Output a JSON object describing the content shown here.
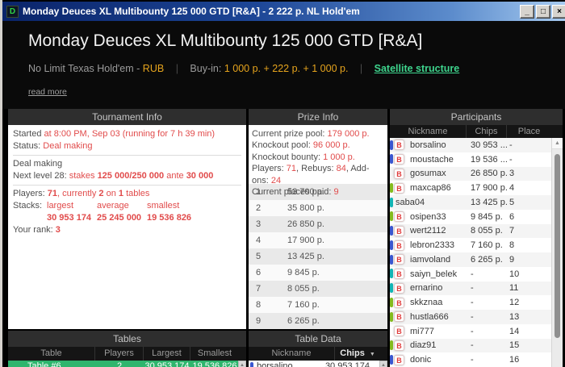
{
  "titlebar": {
    "title": "Monday Deuces XL Multibounty 125 000 GTD [R&A] - 2 222 р. NL Hold'em",
    "icon_letter": "D",
    "minimize_glyph": "_",
    "maximize_glyph": "□",
    "close_glyph": "×"
  },
  "header": {
    "title": "Monday Deuces XL Multibounty 125 000 GTD [R&A]",
    "game_type": "No Limit Texas Hold'em - ",
    "currency": "RUB",
    "pipe": "|",
    "buyin_label": "Buy-in: ",
    "buyin_value": "1 000 р. + 222 р. + 1 000 р.",
    "satellite_link": "Satellite structure",
    "read_more": "read more"
  },
  "tournament_info": {
    "title": "Tournament Info",
    "started_label": "Started",
    "started_value": " at 8:00 PM, Sep 03 (running for 7 h 39 min)",
    "status_label": "Status: ",
    "status_value": "Deal making",
    "deal_making": "Deal making",
    "next_level_label": "Next level 28: ",
    "stakes_word": "stakes ",
    "stakes_value": "125 000/250 000",
    "ante_word": " ante ",
    "ante_value": "30 000",
    "players_label": "Players: ",
    "players_count": "71",
    "players_seg1": ", currently ",
    "players_current": "2",
    "players_seg2": " on ",
    "players_tables": "1",
    "players_seg3": " tables",
    "stacks_label": "Stacks:",
    "stacks_headers": [
      "largest",
      "average",
      "smallest"
    ],
    "stacks_values": [
      "30 953 174",
      "25 245 000",
      "19 536 826"
    ],
    "rank_label": "Your rank: ",
    "rank_value": "3"
  },
  "prize_info": {
    "title": "Prize Info",
    "prize_pool_label": "Current prize pool: ",
    "prize_pool_value": "179 000 р.",
    "knockout_pool_label": "Knockout pool: ",
    "knockout_pool_value": "96 000 р.",
    "knockout_bounty_label": "Knockout bounty: ",
    "knockout_bounty_value": "1 000 р.",
    "players_label": "Players: ",
    "players_value": "71",
    "rebuys_label": ", Rebuys: ",
    "rebuys_value": "84",
    "addons_label": ", Add-ons: ",
    "addons_value": "24",
    "places_paid_label": "Current places paid: ",
    "places_paid_value": "9",
    "places": [
      {
        "place": "1",
        "amount": "53 700 р."
      },
      {
        "place": "2",
        "amount": "35 800 р."
      },
      {
        "place": "3",
        "amount": "26 850 р."
      },
      {
        "place": "4",
        "amount": "17 900 р."
      },
      {
        "place": "5",
        "amount": "13 425 р."
      },
      {
        "place": "6",
        "amount": "9 845 р."
      },
      {
        "place": "7",
        "amount": "8 055 р."
      },
      {
        "place": "8",
        "amount": "7 160 р."
      },
      {
        "place": "9",
        "amount": "6 265 р."
      }
    ]
  },
  "participants": {
    "title": "Participants",
    "columns": [
      "Nickname",
      "Chips",
      "Place"
    ],
    "rows": [
      {
        "flag": "blue",
        "bounty": true,
        "nick": "borsalino",
        "chips": "30 953 ...",
        "place": "-"
      },
      {
        "flag": "blue",
        "bounty": true,
        "nick": "moustache",
        "chips": "19 536 ...",
        "place": "-"
      },
      {
        "flag": "",
        "bounty": true,
        "nick": "gosumax",
        "chips": "26 850 р.",
        "place": "3"
      },
      {
        "flag": "green",
        "bounty": true,
        "nick": "maxcap86",
        "chips": "17 900 р.",
        "place": "4"
      },
      {
        "flag": "teal",
        "bounty": false,
        "nick": "saba04",
        "chips": "13 425 р.",
        "place": "5"
      },
      {
        "flag": "green",
        "bounty": true,
        "nick": "osipen33",
        "chips": "9 845 р.",
        "place": "6"
      },
      {
        "flag": "blue",
        "bounty": true,
        "nick": "wert2112",
        "chips": "8 055 р.",
        "place": "7"
      },
      {
        "flag": "blue",
        "bounty": true,
        "nick": "lebron2333",
        "chips": "7 160 р.",
        "place": "8"
      },
      {
        "flag": "blue",
        "bounty": true,
        "nick": "iamvoland",
        "chips": "6 265 р.",
        "place": "9"
      },
      {
        "flag": "teal",
        "bounty": true,
        "nick": "saiyn_belek",
        "chips": "-",
        "place": "10"
      },
      {
        "flag": "teal",
        "bounty": true,
        "nick": "ernarino",
        "chips": "-",
        "place": "11"
      },
      {
        "flag": "green",
        "bounty": true,
        "nick": "skkznaa",
        "chips": "-",
        "place": "12"
      },
      {
        "flag": "green",
        "bounty": true,
        "nick": "hustla666",
        "chips": "-",
        "place": "13"
      },
      {
        "flag": "",
        "bounty": true,
        "nick": "mi777",
        "chips": "-",
        "place": "14"
      },
      {
        "flag": "green",
        "bounty": true,
        "nick": "diaz91",
        "chips": "-",
        "place": "15"
      },
      {
        "flag": "blue",
        "bounty": true,
        "nick": "donic",
        "chips": "-",
        "place": "16"
      }
    ]
  },
  "tables": {
    "title": "Tables",
    "columns": [
      "Table",
      "Players",
      "Largest",
      "Smallest"
    ],
    "row": {
      "table": "Table #6",
      "players": "2",
      "largest": "30 953 174",
      "smallest": "19 536 826"
    }
  },
  "table_data": {
    "title": "Table Data",
    "nickname_column": "Nickname",
    "chips_column": "Chips",
    "row": {
      "flag": "blue",
      "nick": "borsalino",
      "chips": "30 953 174"
    }
  },
  "icons": {
    "bounty_letter": "B",
    "scroll_up_glyph": "▲",
    "sort_down_glyph": "▼"
  },
  "colors": {
    "accent_red": "#e14b4b",
    "accent_orange": "#e6a41d",
    "link_green": "#3ed48d",
    "selected_row_green": "#2eb56d",
    "flags": {
      "blue": "#3a57d0",
      "green": "#84bb1f",
      "teal": "#12b5b5"
    }
  }
}
